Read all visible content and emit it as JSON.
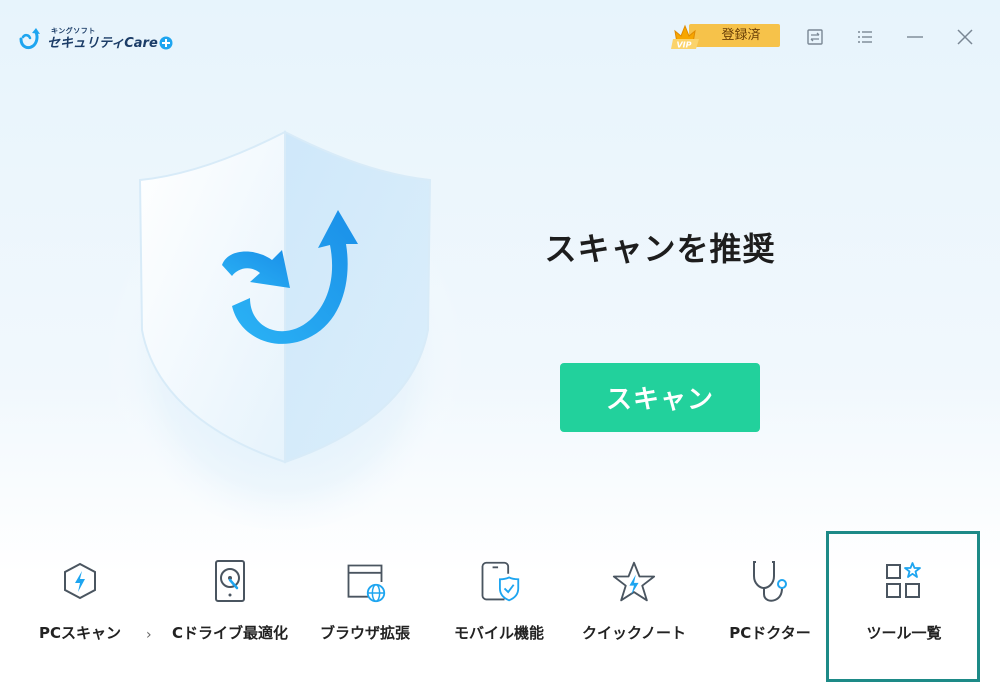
{
  "app": {
    "logo_small": "キングソフト",
    "logo_main": "セキュリティCare"
  },
  "header": {
    "vip_badge": "VIP",
    "vip_status": "登録済"
  },
  "main": {
    "headline": "スキャンを推奨",
    "scan_button": "スキャン"
  },
  "tools": [
    {
      "label": "PCスキャン",
      "icon": "pc-scan-icon"
    },
    {
      "label": "Cドライブ最適化",
      "icon": "drive-optimize-icon"
    },
    {
      "label": "ブラウザ拡張",
      "icon": "browser-extension-icon"
    },
    {
      "label": "モバイル機能",
      "icon": "mobile-shield-icon"
    },
    {
      "label": "クイックノート",
      "icon": "quick-note-star-icon"
    },
    {
      "label": "PCドクター",
      "icon": "stethoscope-icon"
    },
    {
      "label": "ツール一覧",
      "icon": "tool-list-icon"
    }
  ],
  "colors": {
    "accent_green": "#22d19c",
    "highlight": "#1d8a87",
    "vip_gold": "#f6c24a",
    "arrow_blue": "#1ea5f0"
  }
}
